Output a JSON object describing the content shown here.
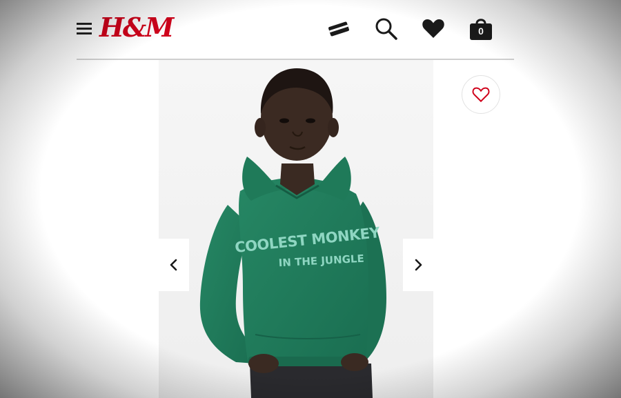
{
  "header": {
    "logo_text": "H&M",
    "icons": [
      "menu-icon",
      "payment-card-icon",
      "search-icon",
      "favourites-heart-icon",
      "shopping-bag-icon"
    ],
    "bag_count": "0"
  },
  "product": {
    "print_line_1": "COOLEST MONKEY",
    "print_line_2": "IN THE JUNGLE",
    "hoodie_color": "#1f7d5c",
    "print_color": "#8fd6c2"
  },
  "gallery": {
    "prev_icon": "chevron-left-icon",
    "next_icon": "chevron-right-icon"
  },
  "colors": {
    "brand_red": "#d0021b",
    "icon_dark": "#1a1a1a"
  }
}
